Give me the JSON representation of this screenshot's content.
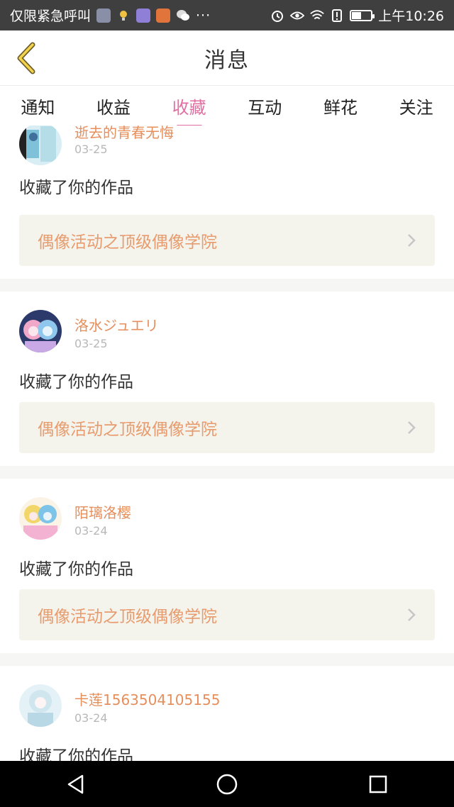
{
  "status_bar": {
    "carrier_text": "仅限紧急呼叫",
    "more": "···",
    "time": "上午10:26",
    "battery_level": 0.5
  },
  "header": {
    "title": "消息",
    "back_icon": "chevron-left-icon"
  },
  "tabs": [
    {
      "label": "通知",
      "active": false
    },
    {
      "label": "收益",
      "active": false
    },
    {
      "label": "收藏",
      "active": true
    },
    {
      "label": "互动",
      "active": false
    },
    {
      "label": "鲜花",
      "active": false
    },
    {
      "label": "关注",
      "active": false
    }
  ],
  "messages": [
    {
      "user": "逝去的青春无悔",
      "date": "03-25",
      "action": "收藏了你的作品",
      "work": "偶像活动之顶级偶像学院"
    },
    {
      "user": "洛水ジュエリ",
      "date": "03-25",
      "action": "收藏了你的作品",
      "work": "偶像活动之顶级偶像学院"
    },
    {
      "user": "陌璃洛樱",
      "date": "03-24",
      "action": "收藏了你的作品",
      "work": "偶像活动之顶级偶像学院"
    },
    {
      "user": "卡莲1563504105155",
      "date": "03-24",
      "action": "收藏了你的作品",
      "work": ""
    }
  ],
  "colors": {
    "accent": "#e26fa3",
    "username": "#e58f5d",
    "work_title": "#e79c6f",
    "work_bg": "#f4f3ec"
  }
}
